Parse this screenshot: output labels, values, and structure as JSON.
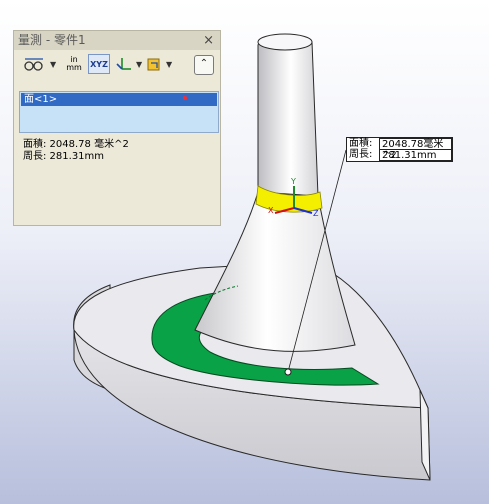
{
  "panel": {
    "title": "量測 - 零件1",
    "close_label": "×",
    "units_label_top": "in",
    "units_label_bottom": "mm",
    "xyz_label": "XYZ",
    "collapse_label": "⌃",
    "selection_item": "面<1>",
    "area_text": "面積: 2048.78 毫米^2",
    "perimeter_text": "周長: 281.31mm"
  },
  "callout": {
    "area_label": "面積:",
    "area_value": "2048.78毫米^2",
    "perimeter_label": "周長:",
    "perimeter_value": "281.31mm"
  },
  "colors": {
    "selected_face": "#0aa246",
    "edge_highlight": "#f4ee00",
    "annotation_red": "#ff1060"
  },
  "icons": [
    "measure-arc-icon",
    "units-icon",
    "xyz-icon",
    "axes-icon",
    "projection-icon",
    "collapse-icon",
    "close-icon"
  ]
}
